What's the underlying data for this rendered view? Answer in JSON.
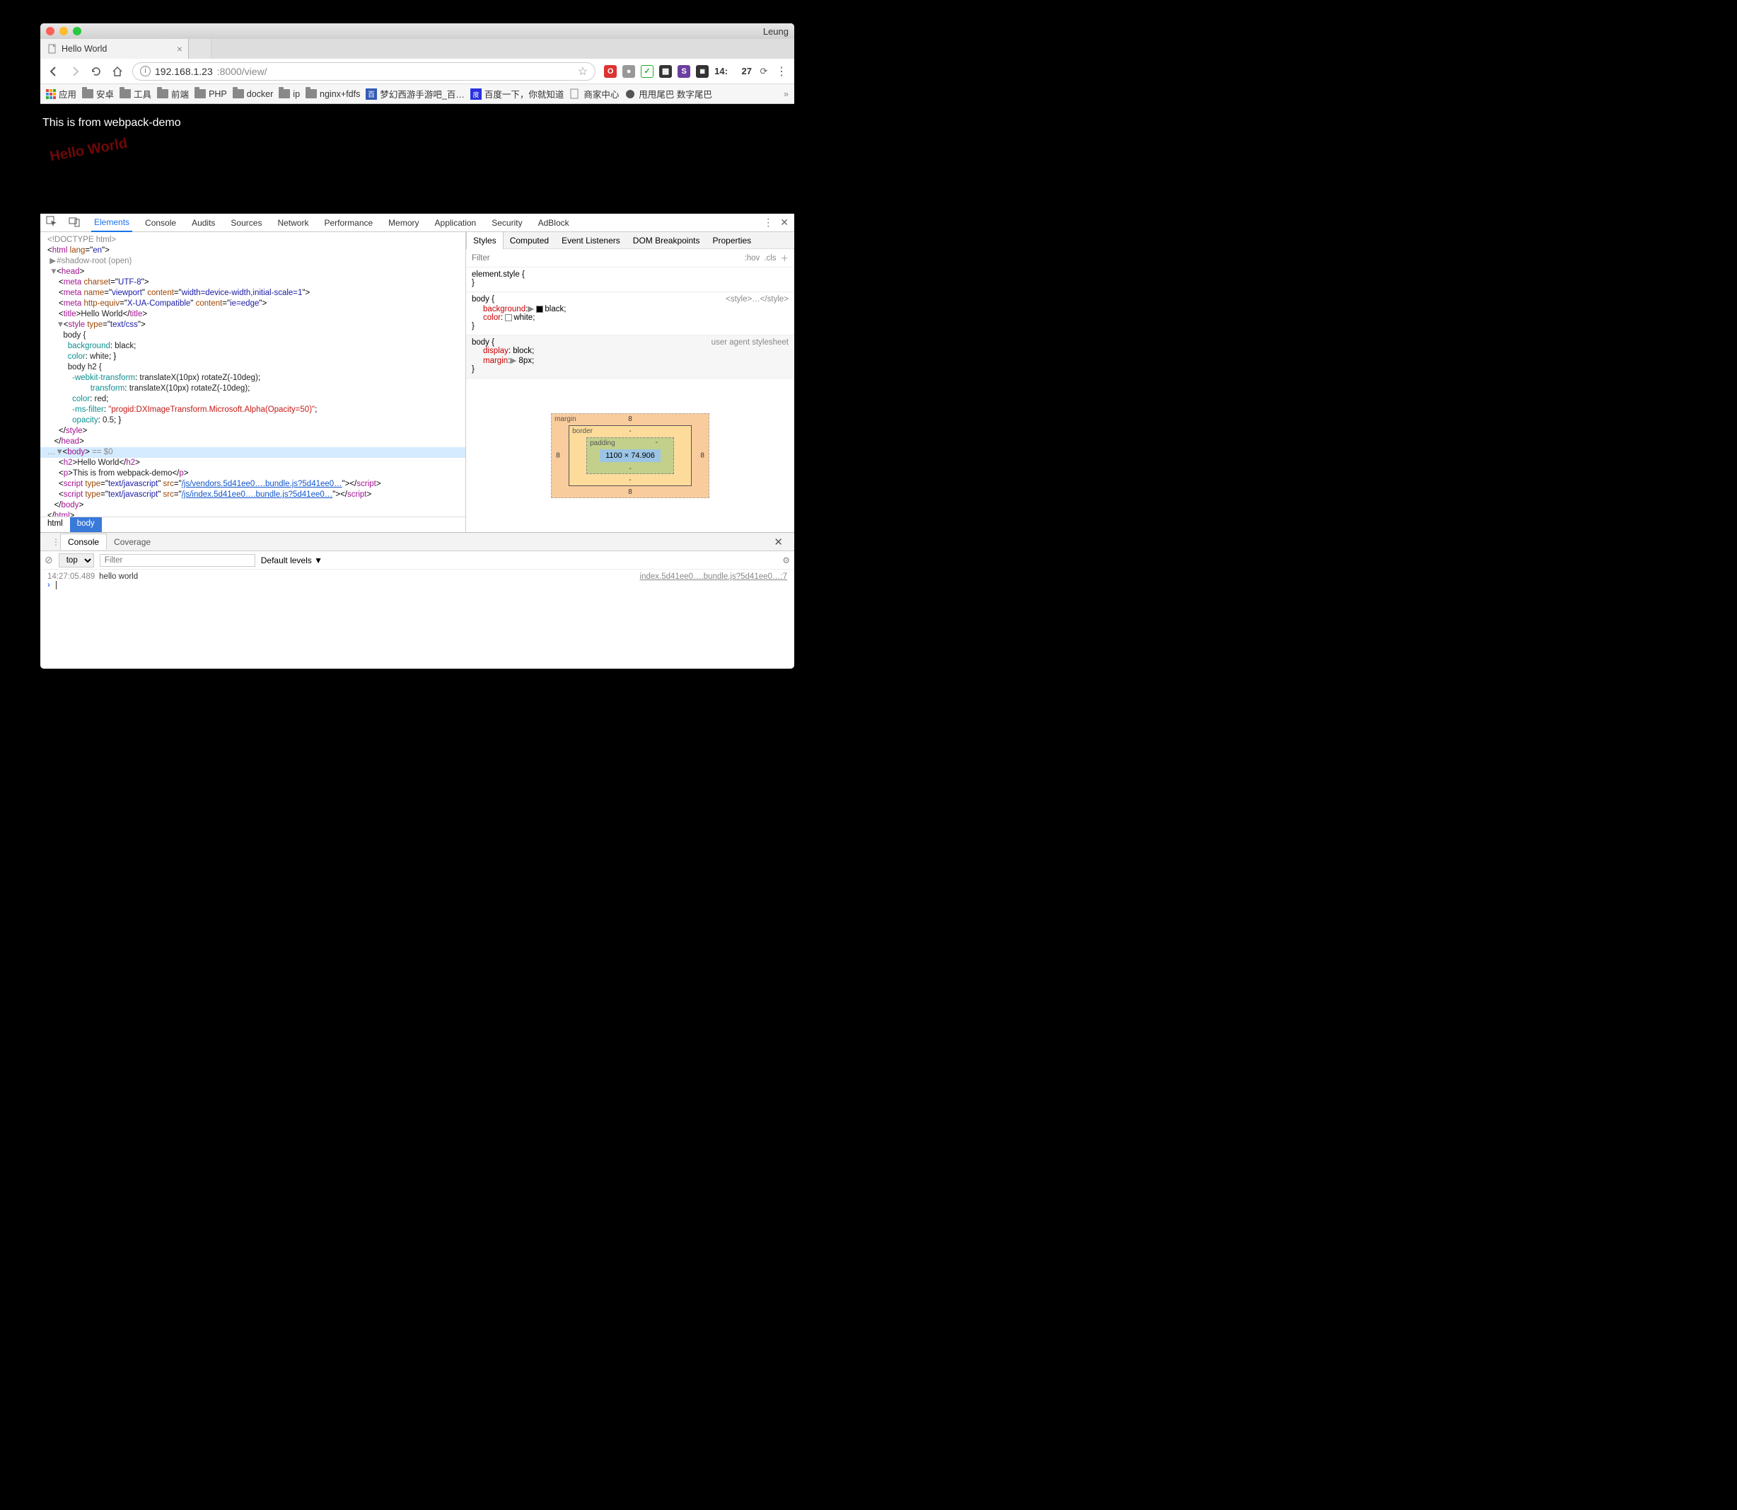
{
  "titlebar": {
    "profile": "Leung"
  },
  "tab": {
    "title": "Hello World"
  },
  "url": {
    "host": "192.168.1.23",
    "rest": ":8000/view/"
  },
  "clock": {
    "hh": "14:",
    "mm": "27"
  },
  "bookmarks": {
    "apps": "应用",
    "folders": [
      "安卓",
      "工具",
      "前端",
      "PHP",
      "docker",
      "ip",
      "nginx+fdfs"
    ],
    "links": [
      {
        "label": "梦幻西游手游吧_百…"
      },
      {
        "label": "百度一下，你就知道"
      },
      {
        "label": "商家中心"
      },
      {
        "label": "甩甩尾巴 数字尾巴"
      }
    ]
  },
  "page": {
    "paragraph": "This is from webpack-demo",
    "heading": "Hello World"
  },
  "devtools": {
    "tabs": [
      "Elements",
      "Console",
      "Audits",
      "Sources",
      "Network",
      "Performance",
      "Memory",
      "Application",
      "Security",
      "AdBlock"
    ],
    "activeTab": "Elements",
    "dom": {
      "doctype": "<!DOCTYPE html>",
      "html_open": "html",
      "lang_attr": "lang",
      "lang_val": "en",
      "shadow": "#shadow-root (open)",
      "head": "head",
      "meta1_a": "charset",
      "meta1_v": "UTF-8",
      "meta2_a1": "name",
      "meta2_v1": "viewport",
      "meta2_a2": "content",
      "meta2_v2": "width=device-width,initial-scale=1",
      "meta3_a1": "http-equiv",
      "meta3_v1": "X-UA-Compatible",
      "meta3_a2": "content",
      "meta3_v2": "ie=edge",
      "title_tag": "title",
      "title_txt": "Hello World",
      "style_a": "type",
      "style_v": "text/css",
      "css_body_open": "body {",
      "css_bg": "background",
      "css_bg_v": "black",
      "css_color": "color",
      "css_color_v": "white",
      "css_h2_open": "body h2 {",
      "css_wt": "-webkit-transform",
      "css_wt_v": "translateX(10px) rotateZ(-10deg)",
      "css_t": "transform",
      "css_t_v": "translateX(10px) rotateZ(-10deg)",
      "css_c2": "color",
      "css_c2_v": "red",
      "css_msf": "-ms-filter",
      "css_msf_v": "\"progid:DXImageTransform.Microsoft.Alpha(Opacity=50)\"",
      "css_op": "opacity",
      "css_op_v": "0.5",
      "body_eq": " == $0",
      "h2_txt": "Hello World",
      "p_txt": "This is from webpack-demo",
      "script_a1": "type",
      "script_v1": "text/javascript",
      "script_a2": "src",
      "script_src1": "/js/vendors.5d41ee0….bundle.js?5d41ee0…",
      "script_src2": "/js/index.5d41ee0….bundle.js?5d41ee0…"
    },
    "crumbs": [
      "html",
      "body"
    ],
    "styles": {
      "tabs": [
        "Styles",
        "Computed",
        "Event Listeners",
        "DOM Breakpoints",
        "Properties"
      ],
      "filter_ph": "Filter",
      "hov": ":hov",
      "cls": ".cls",
      "r1_sel": "element.style {",
      "r1_close": "}",
      "r2_sel": "body {",
      "r2_src": "<style>…</style>",
      "r2_p1": "background",
      "r2_v1": "black",
      "r2_p2": "color",
      "r2_v2": "white",
      "r3_sel": "body {",
      "r3_src": "user agent stylesheet",
      "r3_p1": "display",
      "r3_v1": "block",
      "r3_p2": "margin",
      "r3_v2": "8px",
      "r_close": "}"
    },
    "boxmodel": {
      "margin": "margin",
      "margin_v": "8",
      "border": "border",
      "border_v": "-",
      "padding": "padding",
      "padding_v": "-",
      "content": "1100 × 74.906"
    }
  },
  "drawer": {
    "tabs": [
      "Console",
      "Coverage"
    ],
    "context": "top",
    "filter_ph": "Filter",
    "levels": "Default levels ▼",
    "log_time": "14:27:05.489",
    "log_msg": "hello world",
    "log_src": "index.5d41ee0….bundle.js?5d41ee0…:7"
  }
}
